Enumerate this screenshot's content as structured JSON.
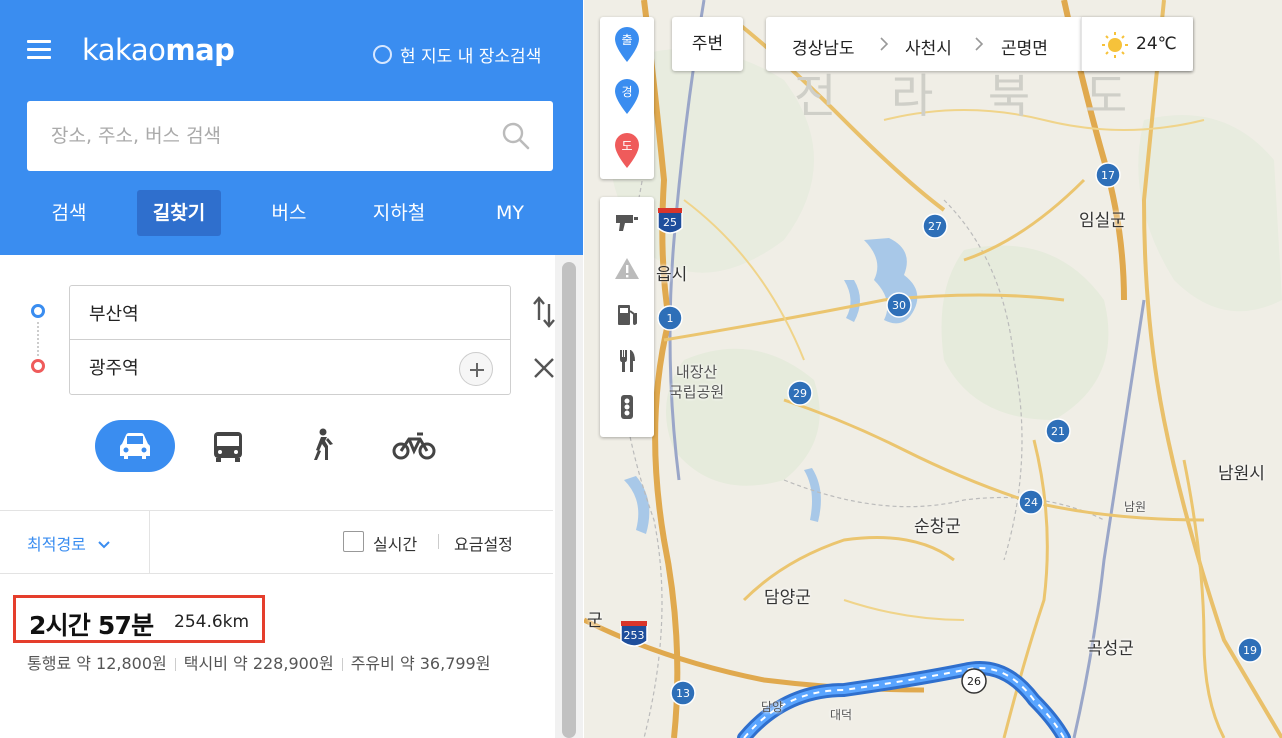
{
  "app": {
    "logo_light": "kakao",
    "logo_bold": "map",
    "current_area_search": "현 지도 내 장소검색"
  },
  "search": {
    "placeholder": "장소, 주소, 버스 검색"
  },
  "tabs": [
    {
      "label": "검색",
      "active": false
    },
    {
      "label": "길찾기",
      "active": true
    },
    {
      "label": "버스",
      "active": false
    },
    {
      "label": "지하철",
      "active": false
    },
    {
      "label": "MY",
      "active": false
    }
  ],
  "route": {
    "origin": "부산역",
    "destination": "광주역"
  },
  "transport_modes": [
    {
      "name": "car",
      "icon": "car-icon",
      "active": true
    },
    {
      "name": "bus",
      "icon": "bus-icon",
      "active": false
    },
    {
      "name": "walk",
      "icon": "walk-icon",
      "active": false
    },
    {
      "name": "bike",
      "icon": "bicycle-icon",
      "active": false
    }
  ],
  "options": {
    "route_type": "최적경로",
    "realtime_label": "실시간",
    "realtime_checked": false,
    "fee_settings": "요금설정"
  },
  "result": {
    "duration": "2시간 57분",
    "distance": "254.6km",
    "toll": "통행료 약 12,800원",
    "taxi": "택시비 약 228,900원",
    "fuel": "주유비 약 36,799원"
  },
  "map": {
    "nearby": "주변",
    "breadcrumb": [
      "경상남도",
      "사천시",
      "곤명면"
    ],
    "temperature": "24℃",
    "weather_icon": "sun-icon",
    "markers": [
      "출",
      "경",
      "도"
    ],
    "labels": {
      "imsil": "임실군",
      "namwon": "남원시",
      "sunchang": "순창군",
      "damyang": "담양군",
      "gokseong": "곡성군",
      "jeongeup": "읍시",
      "park_line1": "내장산",
      "park_line2": "국립공원",
      "gun_left": "군",
      "ghost": "전 라 북 도",
      "namwon_jc": "남원",
      "damyang_jc": "담양",
      "daedeok": "대덕"
    },
    "route_shields": [
      "25",
      "27",
      "17",
      "30",
      "1",
      "29",
      "21",
      "24",
      "19",
      "13",
      "26",
      "253"
    ]
  },
  "colors": {
    "brand_blue": "#3a8df0",
    "highlight_red": "#e53e2c",
    "route_blue": "#3b8ef0"
  }
}
